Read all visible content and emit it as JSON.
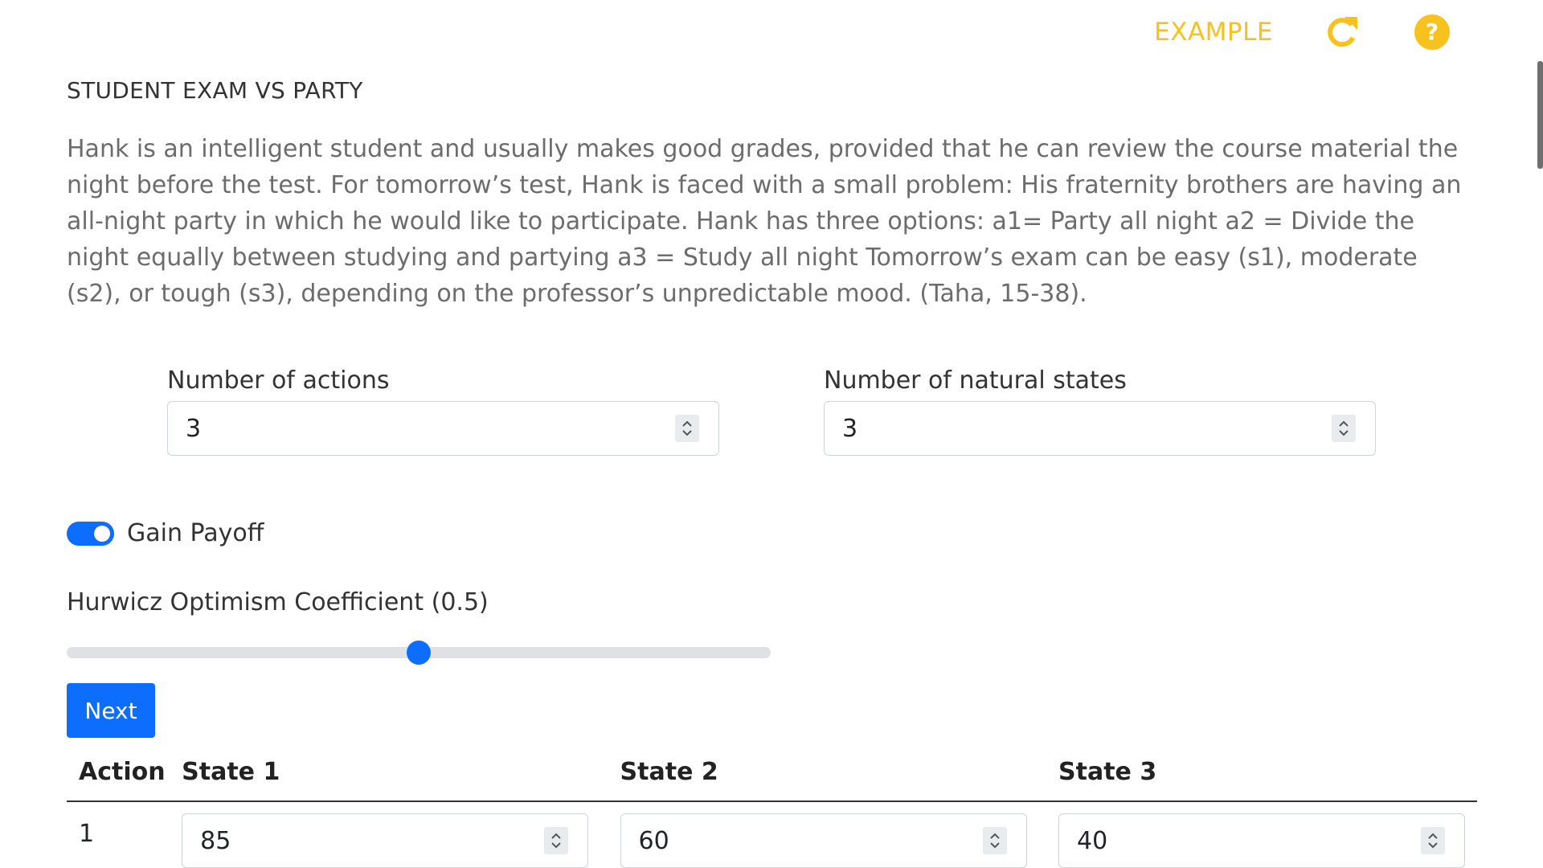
{
  "topbar": {
    "example_label": "EXAMPLE",
    "reload_icon": "reload-icon",
    "help_icon": "help-icon",
    "accent_color": "#f7c21d"
  },
  "problem": {
    "title": "STUDENT EXAM VS PARTY",
    "description": "Hank is an intelligent student and usually makes good grades, provided that he can review the course material the night before the test. For tomorrow’s test, Hank is faced with a small problem: His fraternity brothers are having an all-night party in which he would like to participate. Hank has three options: a1= Party all night a2 = Divide the night equally between studying and partying a3 = Study all night Tomorrow’s exam can be easy (s1), moderate (s2), or tough (s3), depending on the professor’s unpredictable mood. (Taha, 15-38)."
  },
  "inputs": {
    "actions_label": "Number of actions",
    "actions_value": "3",
    "states_label": "Number of natural states",
    "states_value": "3"
  },
  "toggle": {
    "label": "Gain Payoff",
    "checked": true
  },
  "slider": {
    "label": "Hurwicz Optimism Coefficient (0.5)",
    "value": 0.5
  },
  "next_label": "Next",
  "table": {
    "headers": [
      "Action",
      "State 1",
      "State 2",
      "State 3"
    ],
    "rows": [
      {
        "action": "1",
        "values": [
          "85",
          "60",
          "40"
        ]
      }
    ]
  },
  "colors": {
    "primary": "#0d6efd",
    "text_muted": "#6c6c6c"
  }
}
